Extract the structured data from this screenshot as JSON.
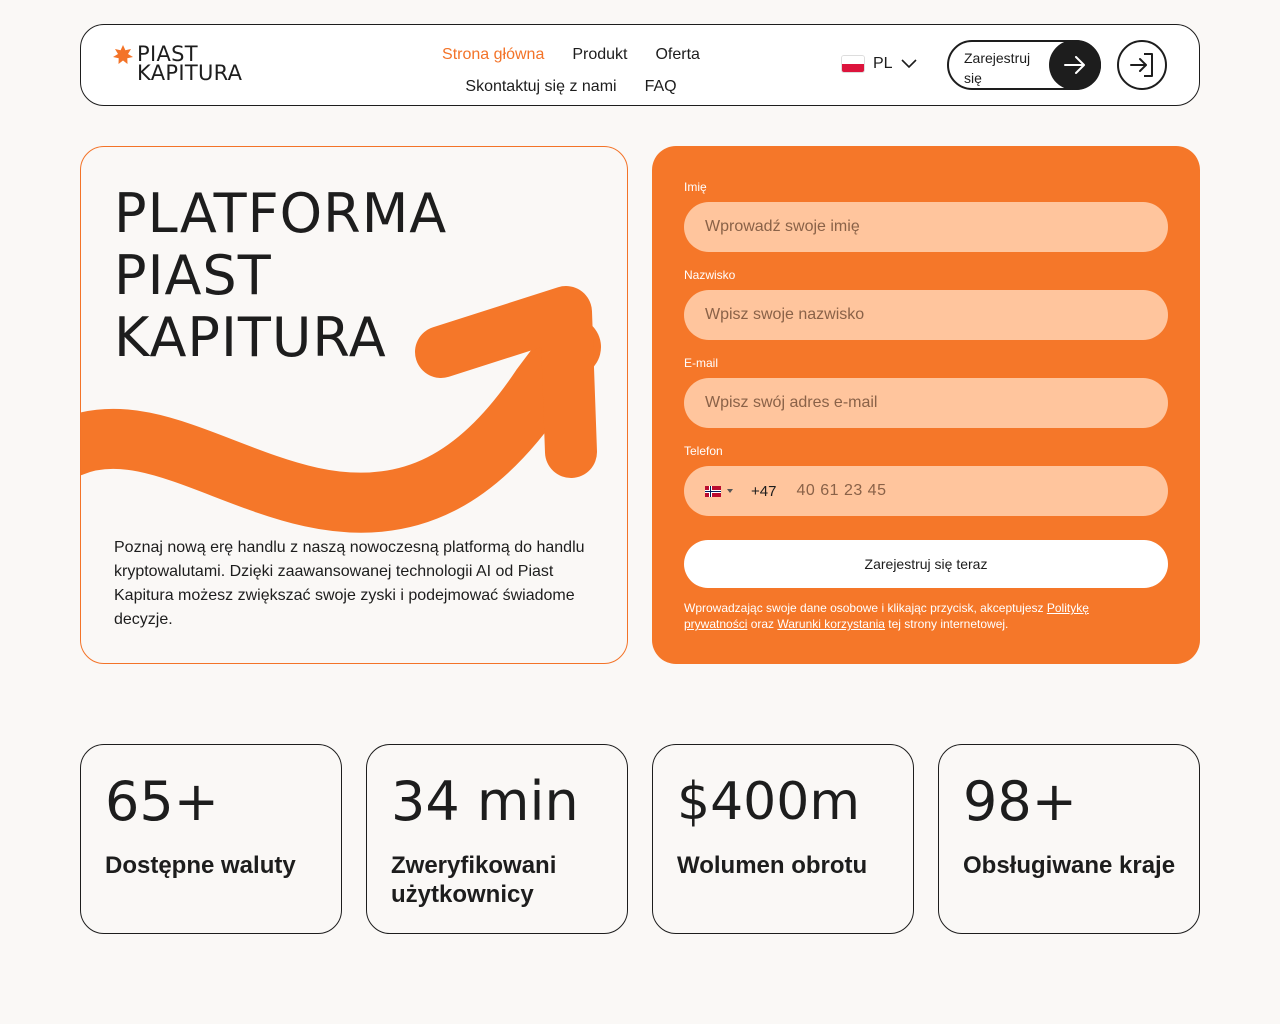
{
  "brand": {
    "name_line1": "PIAST",
    "name_line2": "KAPITURA",
    "accent_color": "#f37328"
  },
  "nav": {
    "items": [
      {
        "label": "Strona główna",
        "active": true
      },
      {
        "label": "Produkt"
      },
      {
        "label": "Oferta"
      },
      {
        "label": "Skontaktuj się z nami"
      },
      {
        "label": "FAQ"
      }
    ]
  },
  "language": {
    "flag_icon": "poland-flag-icon",
    "code": "PL"
  },
  "header_actions": {
    "register_label": "Zarejestruj się",
    "register_icon": "arrow-right-icon",
    "login_icon": "login-icon"
  },
  "hero": {
    "title_line1": "PLATFORMA",
    "title_line2": "PIAST",
    "title_line3": "KAPITURA",
    "description": "Poznaj nową erę handlu z naszą nowoczesną platformą do handlu kryptowalutami. Dzięki zaawansowanej technologii AI od Piast Kapitura możesz zwiększać swoje zyski i podejmować świadome decyzje."
  },
  "form": {
    "first_name_label": "Imię",
    "first_name_placeholder": "Wprowadź swoje imię",
    "last_name_label": "Nazwisko",
    "last_name_placeholder": "Wpisz swoje nazwisko",
    "email_label": "E-mail",
    "email_placeholder": "Wpisz swój adres e-mail",
    "phone_label": "Telefon",
    "phone_flag_icon": "norway-flag-icon",
    "phone_dial_code": "+47",
    "phone_placeholder": "40 61 23 45",
    "submit_label": "Zarejestruj się teraz",
    "consent_prefix": "Wprowadzając swoje dane osobowe i klikając przycisk, akceptujesz ",
    "privacy_link": "Politykę prywatności",
    "consent_middle": " oraz ",
    "terms_link": "Warunki korzystania",
    "consent_suffix": " tej strony internetowej."
  },
  "stats": [
    {
      "value": "65+",
      "label": "Dostępne waluty"
    },
    {
      "value": "34 min",
      "label": "Zweryfikowani użytkownicy"
    },
    {
      "value": "$400m",
      "label": "Wolumen obrotu"
    },
    {
      "value": "98+",
      "label": "Obsługiwane kraje"
    }
  ]
}
